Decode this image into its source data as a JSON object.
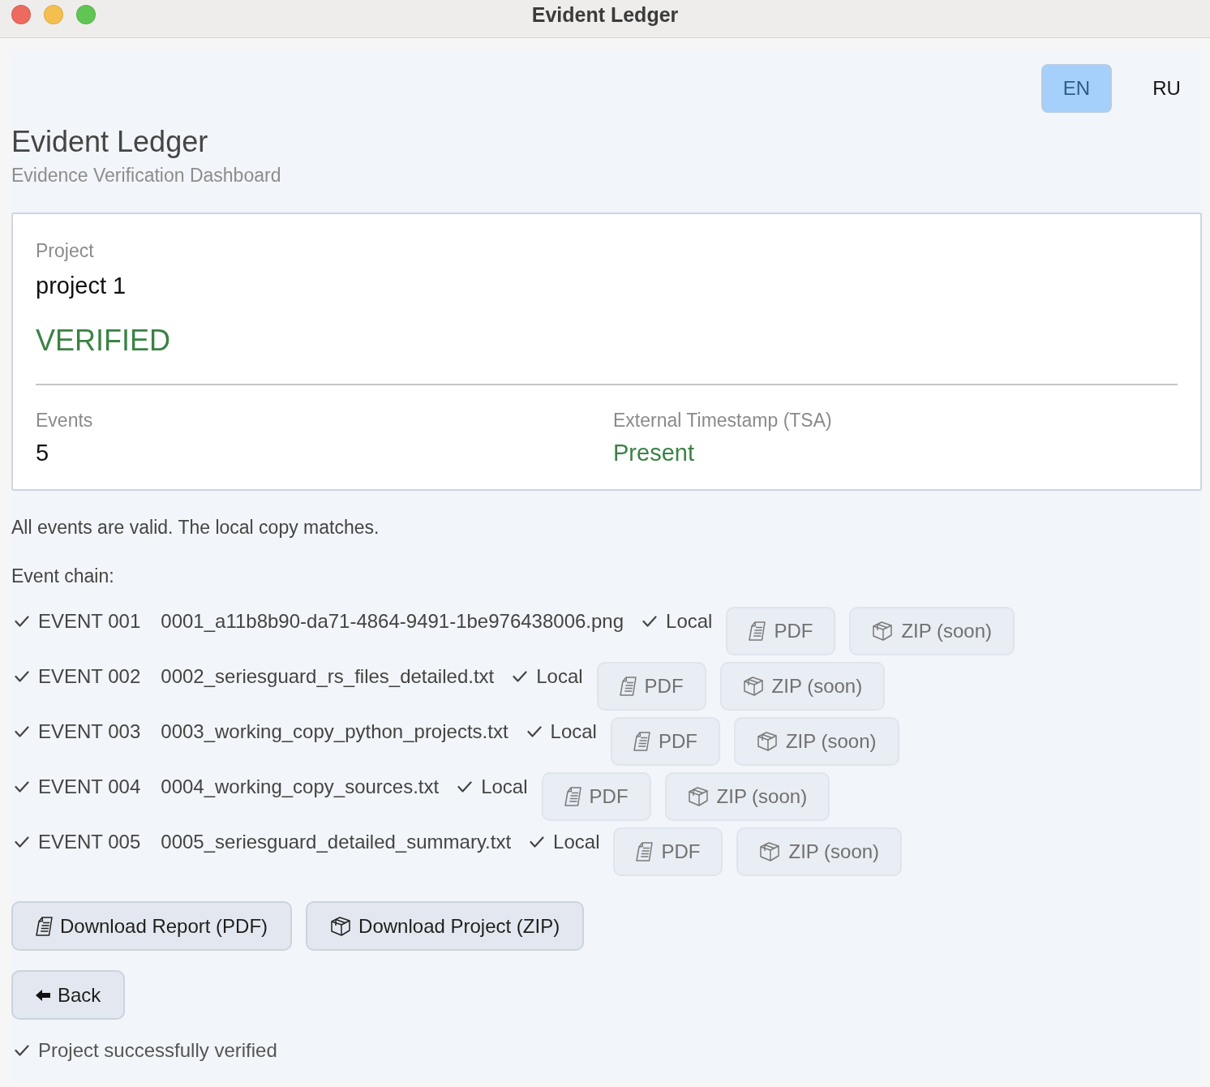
{
  "window": {
    "title": "Evident Ledger"
  },
  "languages": [
    {
      "label": "EN",
      "selected": true
    },
    {
      "label": "RU",
      "selected": false
    }
  ],
  "header": {
    "title": "Evident Ledger",
    "subtitle": "Evidence Verification Dashboard"
  },
  "summary": {
    "project_label": "Project",
    "project_name": "project 1",
    "status": "VERIFIED",
    "events_label": "Events",
    "events_count": "5",
    "tsa_label": "External Timestamp (TSA)",
    "tsa_value": "Present"
  },
  "result_message": "All events are valid. The local copy matches.",
  "chain_label": "Event chain:",
  "events": [
    {
      "valid": true,
      "id": "EVENT 001",
      "file": "0001_a11b8b90-da71-4864-9491-1be976438006.png",
      "local_valid": true,
      "local_label": "Local",
      "buttons": [
        {
          "kind": "pdf",
          "label": "PDF"
        },
        {
          "kind": "zip",
          "label": "ZIP (soon)"
        }
      ]
    },
    {
      "valid": true,
      "id": "EVENT 002",
      "file": "0002_seriesguard_rs_files_detailed.txt",
      "local_valid": true,
      "local_label": "Local",
      "buttons": [
        {
          "kind": "pdf",
          "label": "PDF"
        },
        {
          "kind": "zip",
          "label": "ZIP (soon)"
        }
      ]
    },
    {
      "valid": true,
      "id": "EVENT 003",
      "file": "0003_working_copy_python_projects.txt",
      "local_valid": true,
      "local_label": "Local",
      "buttons": [
        {
          "kind": "pdf",
          "label": "PDF"
        },
        {
          "kind": "zip",
          "label": "ZIP (soon)"
        }
      ]
    },
    {
      "valid": true,
      "id": "EVENT 004",
      "file": "0004_working_copy_sources.txt",
      "local_valid": true,
      "local_label": "Local",
      "buttons": [
        {
          "kind": "pdf",
          "label": "PDF"
        },
        {
          "kind": "zip",
          "label": "ZIP (soon)"
        }
      ]
    },
    {
      "valid": true,
      "id": "EVENT 005",
      "file": "0005_seriesguard_detailed_summary.txt",
      "local_valid": true,
      "local_label": "Local",
      "buttons": [
        {
          "kind": "pdf",
          "label": "PDF"
        },
        {
          "kind": "zip",
          "label": "ZIP (soon)"
        }
      ]
    }
  ],
  "actions": [
    {
      "kind": "pdf",
      "label": "Download Report (PDF)"
    },
    {
      "kind": "zip",
      "label": "Download Project (ZIP)"
    }
  ],
  "back": {
    "label": "Back"
  },
  "status": {
    "ok": true,
    "text": "Project successfully verified"
  }
}
